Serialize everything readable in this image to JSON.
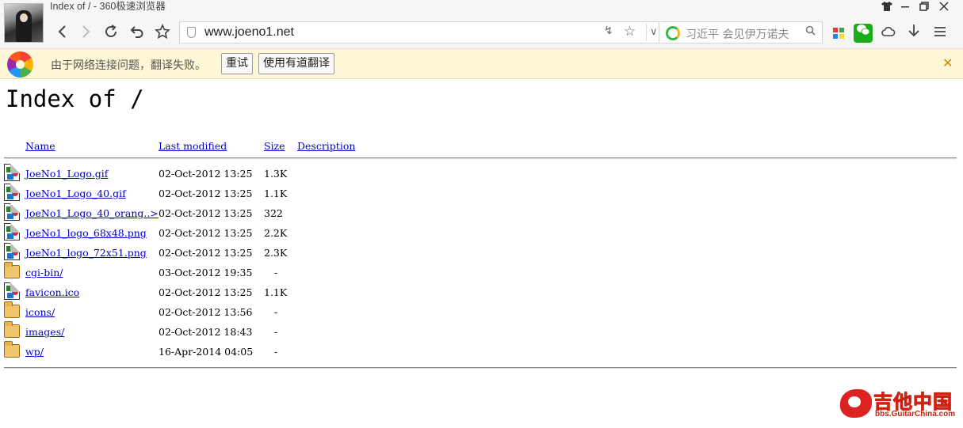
{
  "window": {
    "title": "Index of / - 360极速浏览器",
    "controls": [
      "shirt-icon",
      "minimize-icon",
      "restore-icon",
      "close-icon"
    ]
  },
  "toolbar": {
    "address": "www.joeno1.net",
    "search_placeholder": "习近平 会见伊万诺夫",
    "icons": [
      "back-icon",
      "forward-icon",
      "reload-icon",
      "undo-icon",
      "bookmark-star-icon",
      "shield-icon",
      "lightning-icon",
      "favorite-star-icon",
      "dropdown-icon",
      "search-engine-icon",
      "search-icon",
      "apps-icon",
      "wechat-icon",
      "cloud-icon",
      "download-icon",
      "menu-icon"
    ]
  },
  "translate_bar": {
    "message": "由于网络连接问题，翻译失败。",
    "retry_label": "重试",
    "youdao_label": "使用有道翻译"
  },
  "page": {
    "title": "Index of /",
    "columns": {
      "name": "Name",
      "modified": "Last modified",
      "size": "Size",
      "description": "Description"
    },
    "entries": [
      {
        "icon": "image",
        "name": "JoeNo1_Logo.gif",
        "modified": "02-Oct-2012 13:25",
        "size": "1.3K"
      },
      {
        "icon": "image",
        "name": "JoeNo1_Logo_40.gif",
        "modified": "02-Oct-2012 13:25",
        "size": "1.1K"
      },
      {
        "icon": "image",
        "name": "JoeNo1_Logo_40_orang..>",
        "modified": "02-Oct-2012 13:25",
        "size": "322"
      },
      {
        "icon": "image",
        "name": "JoeNo1_logo_68x48.png",
        "modified": "02-Oct-2012 13:25",
        "size": "2.2K"
      },
      {
        "icon": "image",
        "name": "JoeNo1_logo_72x51.png",
        "modified": "02-Oct-2012 13:25",
        "size": "2.3K"
      },
      {
        "icon": "folder",
        "name": "cgi-bin/",
        "modified": "03-Oct-2012 19:35",
        "size": "-"
      },
      {
        "icon": "image",
        "name": "favicon.ico",
        "modified": "02-Oct-2012 13:25",
        "size": "1.1K"
      },
      {
        "icon": "folder",
        "name": "icons/",
        "modified": "02-Oct-2012 13:56",
        "size": "-"
      },
      {
        "icon": "folder",
        "name": "images/",
        "modified": "02-Oct-2012 18:43",
        "size": "-"
      },
      {
        "icon": "folder",
        "name": "wp/",
        "modified": "16-Apr-2014 04:05",
        "size": "-"
      }
    ]
  },
  "watermark": {
    "title": "吉他中国",
    "url": "bbs.GuitarChina.com"
  }
}
